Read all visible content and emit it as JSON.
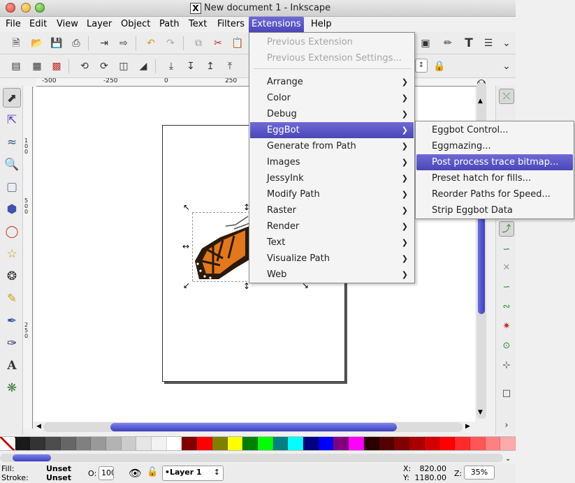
{
  "window": {
    "title": "New document 1 - Inkscape",
    "x_logo": "X"
  },
  "menubar": {
    "items": [
      {
        "label": "File"
      },
      {
        "label": "Edit"
      },
      {
        "label": "View"
      },
      {
        "label": "Layer"
      },
      {
        "label": "Object"
      },
      {
        "label": "Path"
      },
      {
        "label": "Text"
      },
      {
        "label": "Filters"
      },
      {
        "label": "Extensions"
      },
      {
        "label": "Help"
      }
    ],
    "active": "Extensions"
  },
  "extensions_menu": {
    "items": [
      {
        "label": "Previous Extension",
        "disabled": true
      },
      {
        "label": "Previous Extension Settings...",
        "disabled": true
      },
      {
        "label": "Arrange"
      },
      {
        "label": "Color"
      },
      {
        "label": "Debug"
      },
      {
        "label": "EggBot"
      },
      {
        "label": "Generate from Path"
      },
      {
        "label": "Images"
      },
      {
        "label": "JessyInk"
      },
      {
        "label": "Modify Path"
      },
      {
        "label": "Raster"
      },
      {
        "label": "Render"
      },
      {
        "label": "Text"
      },
      {
        "label": "Visualize Path"
      },
      {
        "label": "Web"
      }
    ],
    "highlighted": "EggBot"
  },
  "eggbot_submenu": {
    "items": [
      {
        "label": "Eggbot Control..."
      },
      {
        "label": "Eggmazing..."
      },
      {
        "label": "Post process trace bitmap..."
      },
      {
        "label": "Preset hatch for fills..."
      },
      {
        "label": "Reorder Paths for Speed..."
      },
      {
        "label": "Strip Eggbot Data"
      }
    ],
    "highlighted": "Post process trace bitmap..."
  },
  "ruler": {
    "h_labels": [
      "-500",
      "-250",
      "0",
      "250"
    ],
    "v_labels": [
      "100",
      "500",
      "250"
    ]
  },
  "statusbar": {
    "fill_label": "Fill:",
    "fill_value": "Unset",
    "stroke_label": "Stroke:",
    "stroke_value": "Unset",
    "opacity_label": "O:",
    "opacity_value": "100",
    "layer": "•Layer 1",
    "x_label": "X:",
    "x_value": "820.00",
    "y_label": "Y:",
    "y_value": "1180.00",
    "zoom_label": "Z:",
    "zoom_value": "35%"
  },
  "icons": {
    "toolbox": [
      "selector-arrow-icon",
      "node-tool-icon",
      "tweak-tool-icon",
      "zoom-tool-icon",
      "rectangle-tool-icon",
      "3d-box-tool-icon",
      "ellipse-tool-icon",
      "star-tool-icon",
      "spiral-tool-icon",
      "pencil-tool-icon",
      "pen-tool-icon",
      "calligraphy-tool-icon",
      "text-tool-icon",
      "spray-tool-icon"
    ]
  },
  "palette": [
    "#ffffff",
    "#1a1a1a",
    "#333333",
    "#4d4d4d",
    "#666666",
    "#808080",
    "#999999",
    "#b3b3b3",
    "#cccccc",
    "#e6e6e6",
    "#f2f2f2",
    "#ffffff",
    "#800000",
    "#ff0000",
    "#808000",
    "#ffff00",
    "#008000",
    "#00ff00",
    "#008080",
    "#00ffff",
    "#000080",
    "#0000ff",
    "#800080",
    "#ff00ff",
    "#2b0000",
    "#550000",
    "#800000",
    "#aa0000",
    "#d40000",
    "#ff0000",
    "#ff2a2a",
    "#ff5555",
    "#ff8080",
    "#ffaaaa"
  ]
}
